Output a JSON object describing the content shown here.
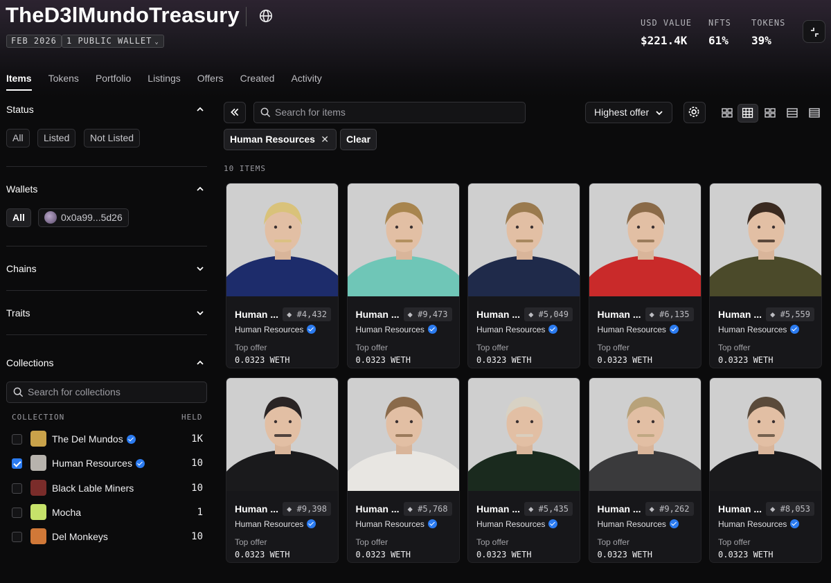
{
  "header": {
    "title": "TheD3lMundoTreasury",
    "tags": [
      "FEB 2026",
      "1 PUBLIC WALLET"
    ],
    "stats": [
      {
        "label": "USD VALUE",
        "value": "$221.4K"
      },
      {
        "label": "NFTS",
        "value": "61%"
      },
      {
        "label": "TOKENS",
        "value": "39%"
      }
    ]
  },
  "tabs": [
    "Items",
    "Tokens",
    "Portfolio",
    "Listings",
    "Offers",
    "Created",
    "Activity"
  ],
  "sidebar": {
    "status": {
      "title": "Status",
      "options": [
        "All",
        "Listed",
        "Not Listed"
      ]
    },
    "wallets": {
      "title": "Wallets",
      "options": [
        "All",
        "0x0a99...5d26"
      ]
    },
    "chains": {
      "title": "Chains"
    },
    "traits": {
      "title": "Traits"
    },
    "collections": {
      "title": "Collections",
      "search_placeholder": "Search for collections",
      "col_collection": "COLLECTION",
      "col_held": "HELD",
      "items": [
        {
          "name": "The Del Mundos",
          "verified": true,
          "held": "1K",
          "checked": false,
          "thumb": "#c9a24a"
        },
        {
          "name": "Human Resources",
          "verified": true,
          "held": "10",
          "checked": true,
          "thumb": "#b7b3ad"
        },
        {
          "name": "Black Lable Miners",
          "verified": false,
          "held": "10",
          "checked": false,
          "thumb": "#7a2c2a"
        },
        {
          "name": "Mocha",
          "verified": false,
          "held": "1",
          "checked": false,
          "thumb": "#c6e26a"
        },
        {
          "name": "Del Monkeys",
          "verified": false,
          "held": "10",
          "checked": false,
          "thumb": "#d07838"
        }
      ]
    }
  },
  "toolbar": {
    "search_placeholder": "Search for items",
    "sort_label": "Highest offer",
    "filter_chip": "Human Resources",
    "clear_label": "Clear",
    "item_count": "10 ITEMS"
  },
  "cards": [
    {
      "name": "Human ...",
      "number": "#4,432",
      "collection": "Human Resources",
      "offer_label": "Top offer",
      "offer": "0.0323 WETH",
      "hair": "#d9c27a",
      "shirt": "#1d2c6b"
    },
    {
      "name": "Human ...",
      "number": "#9,473",
      "collection": "Human Resources",
      "offer_label": "Top offer",
      "offer": "0.0323 WETH",
      "hair": "#a8854e",
      "shirt": "#6fc6b7"
    },
    {
      "name": "Human ...",
      "number": "#5,049",
      "collection": "Human Resources",
      "offer_label": "Top offer",
      "offer": "0.0323 WETH",
      "hair": "#9a7a4e",
      "shirt": "#1f2a4a"
    },
    {
      "name": "Human ...",
      "number": "#6,135",
      "collection": "Human Resources",
      "offer_label": "Top offer",
      "offer": "0.0323 WETH",
      "hair": "#8a6a48",
      "shirt": "#c92a2a"
    },
    {
      "name": "Human ...",
      "number": "#5,559",
      "collection": "Human Resources",
      "offer_label": "Top offer",
      "offer": "0.0323 WETH",
      "hair": "#3a2a20",
      "shirt": "#4b4a2a"
    },
    {
      "name": "Human ...",
      "number": "#9,398",
      "collection": "Human Resources",
      "offer_label": "Top offer",
      "offer": "0.0323 WETH",
      "hair": "#2a2424",
      "shirt": "#1a1a1c"
    },
    {
      "name": "Human ...",
      "number": "#5,768",
      "collection": "Human Resources",
      "offer_label": "Top offer",
      "offer": "0.0323 WETH",
      "hair": "#8a6a4a",
      "shirt": "#e8e6e2"
    },
    {
      "name": "Human ...",
      "number": "#5,435",
      "collection": "Human Resources",
      "offer_label": "Top offer",
      "offer": "0.0323 WETH",
      "hair": "#d8d2c4",
      "shirt": "#1a2a1e"
    },
    {
      "name": "Human ...",
      "number": "#9,262",
      "collection": "Human Resources",
      "offer_label": "Top offer",
      "offer": "0.0323 WETH",
      "hair": "#b8a27a",
      "shirt": "#3a3a3c"
    },
    {
      "name": "Human ...",
      "number": "#8,053",
      "collection": "Human Resources",
      "offer_label": "Top offer",
      "offer": "0.0323 WETH",
      "hair": "#5a4a3a",
      "shirt": "#1a1a1c"
    }
  ]
}
